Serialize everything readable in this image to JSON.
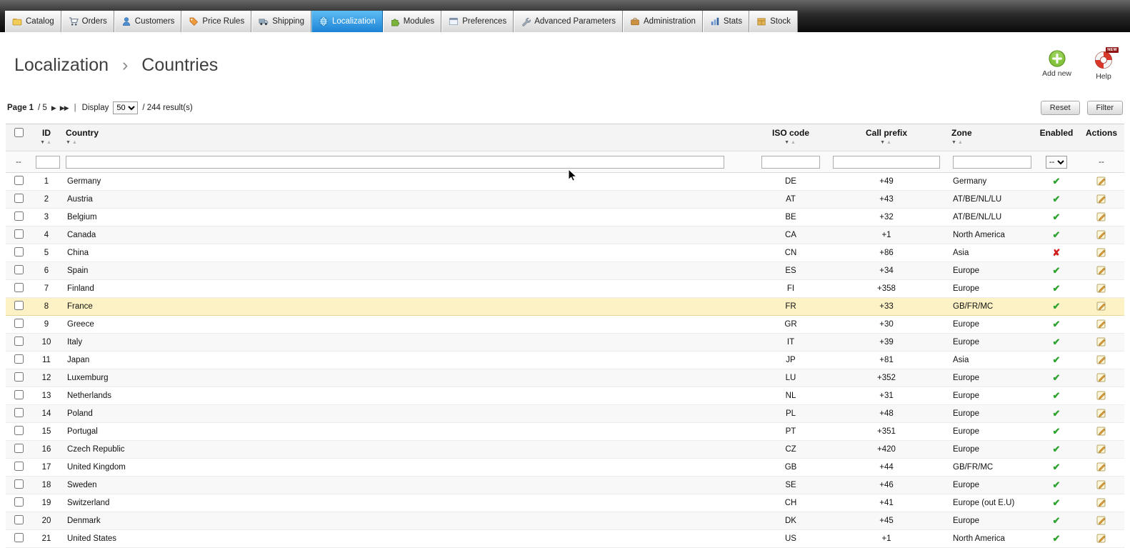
{
  "nav": {
    "tabs": [
      {
        "label": "Catalog",
        "icon": "folder",
        "active": false
      },
      {
        "label": "Orders",
        "icon": "cart",
        "active": false
      },
      {
        "label": "Customers",
        "icon": "person",
        "active": false
      },
      {
        "label": "Price Rules",
        "icon": "tag",
        "active": false
      },
      {
        "label": "Shipping",
        "icon": "truck",
        "active": false
      },
      {
        "label": "Localization",
        "icon": "globe",
        "active": true
      },
      {
        "label": "Modules",
        "icon": "puzzle",
        "active": false
      },
      {
        "label": "Preferences",
        "icon": "window",
        "active": false
      },
      {
        "label": "Advanced Parameters",
        "icon": "wrench",
        "active": false
      },
      {
        "label": "Administration",
        "icon": "briefcase",
        "active": false
      },
      {
        "label": "Stats",
        "icon": "chart",
        "active": false
      },
      {
        "label": "Stock",
        "icon": "box",
        "active": false
      }
    ]
  },
  "breadcrumb": {
    "section": "Localization",
    "separator": "›",
    "page": "Countries"
  },
  "header_actions": {
    "add_new_label": "Add new",
    "help_label": "Help",
    "help_badge": "NEW"
  },
  "toolbar": {
    "page_label": "Page 1",
    "page_total": "/ 5",
    "next_arrow": "▶",
    "last_arrow": "▶▶",
    "display_label": "Display",
    "display_value": "50",
    "results_label": "/ 244 result(s)",
    "reset_label": "Reset",
    "filter_label": "Filter"
  },
  "table": {
    "headers": {
      "id": "ID",
      "country": "Country",
      "iso": "ISO code",
      "prefix": "Call prefix",
      "zone": "Zone",
      "enabled": "Enabled",
      "actions": "Actions"
    },
    "filter_dash": "--",
    "enabled_filter_value": "--",
    "rows": [
      {
        "id": 1,
        "country": "Germany",
        "iso": "DE",
        "prefix": "+49",
        "zone": "Germany",
        "enabled": true,
        "highlighted": false
      },
      {
        "id": 2,
        "country": "Austria",
        "iso": "AT",
        "prefix": "+43",
        "zone": "AT/BE/NL/LU",
        "enabled": true,
        "highlighted": false
      },
      {
        "id": 3,
        "country": "Belgium",
        "iso": "BE",
        "prefix": "+32",
        "zone": "AT/BE/NL/LU",
        "enabled": true,
        "highlighted": false
      },
      {
        "id": 4,
        "country": "Canada",
        "iso": "CA",
        "prefix": "+1",
        "zone": "North America",
        "enabled": true,
        "highlighted": false
      },
      {
        "id": 5,
        "country": "China",
        "iso": "CN",
        "prefix": "+86",
        "zone": "Asia",
        "enabled": false,
        "highlighted": false
      },
      {
        "id": 6,
        "country": "Spain",
        "iso": "ES",
        "prefix": "+34",
        "zone": "Europe",
        "enabled": true,
        "highlighted": false
      },
      {
        "id": 7,
        "country": "Finland",
        "iso": "FI",
        "prefix": "+358",
        "zone": "Europe",
        "enabled": true,
        "highlighted": false
      },
      {
        "id": 8,
        "country": "France",
        "iso": "FR",
        "prefix": "+33",
        "zone": "GB/FR/MC",
        "enabled": true,
        "highlighted": true
      },
      {
        "id": 9,
        "country": "Greece",
        "iso": "GR",
        "prefix": "+30",
        "zone": "Europe",
        "enabled": true,
        "highlighted": false
      },
      {
        "id": 10,
        "country": "Italy",
        "iso": "IT",
        "prefix": "+39",
        "zone": "Europe",
        "enabled": true,
        "highlighted": false
      },
      {
        "id": 11,
        "country": "Japan",
        "iso": "JP",
        "prefix": "+81",
        "zone": "Asia",
        "enabled": true,
        "highlighted": false
      },
      {
        "id": 12,
        "country": "Luxemburg",
        "iso": "LU",
        "prefix": "+352",
        "zone": "Europe",
        "enabled": true,
        "highlighted": false
      },
      {
        "id": 13,
        "country": "Netherlands",
        "iso": "NL",
        "prefix": "+31",
        "zone": "Europe",
        "enabled": true,
        "highlighted": false
      },
      {
        "id": 14,
        "country": "Poland",
        "iso": "PL",
        "prefix": "+48",
        "zone": "Europe",
        "enabled": true,
        "highlighted": false
      },
      {
        "id": 15,
        "country": "Portugal",
        "iso": "PT",
        "prefix": "+351",
        "zone": "Europe",
        "enabled": true,
        "highlighted": false
      },
      {
        "id": 16,
        "country": "Czech Republic",
        "iso": "CZ",
        "prefix": "+420",
        "zone": "Europe",
        "enabled": true,
        "highlighted": false
      },
      {
        "id": 17,
        "country": "United Kingdom",
        "iso": "GB",
        "prefix": "+44",
        "zone": "GB/FR/MC",
        "enabled": true,
        "highlighted": false
      },
      {
        "id": 18,
        "country": "Sweden",
        "iso": "SE",
        "prefix": "+46",
        "zone": "Europe",
        "enabled": true,
        "highlighted": false
      },
      {
        "id": 19,
        "country": "Switzerland",
        "iso": "CH",
        "prefix": "+41",
        "zone": "Europe (out E.U)",
        "enabled": true,
        "highlighted": false
      },
      {
        "id": 20,
        "country": "Denmark",
        "iso": "DK",
        "prefix": "+45",
        "zone": "Europe",
        "enabled": true,
        "highlighted": false
      },
      {
        "id": 21,
        "country": "United States",
        "iso": "US",
        "prefix": "+1",
        "zone": "North America",
        "enabled": true,
        "highlighted": false
      }
    ]
  },
  "colors": {
    "active_tab_blue": "#1c83d6",
    "enabled_green": "#2fa32f",
    "disabled_red": "#d21d1d",
    "row_highlight": "#fdf2c5"
  }
}
